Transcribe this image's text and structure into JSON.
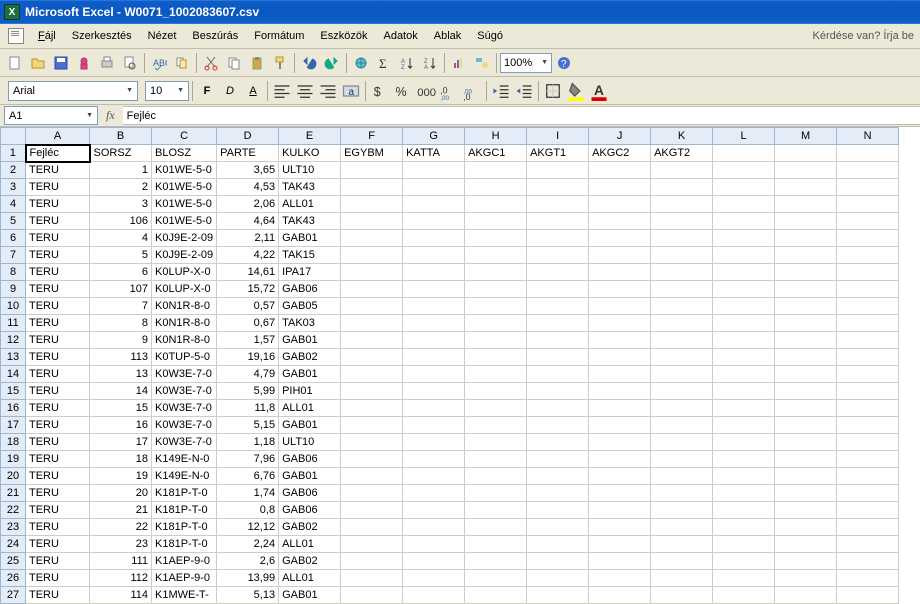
{
  "title": "Microsoft Excel - W0071_1002083607.csv",
  "question_prompt": "Kérdése van? Írja be",
  "menu": {
    "file": "Fájl",
    "edit": "Szerkesztés",
    "view": "Nézet",
    "insert": "Beszúrás",
    "format": "Formátum",
    "tools": "Eszközök",
    "data": "Adatok",
    "window": "Ablak",
    "help": "Súgó"
  },
  "toolbar": {
    "zoom": "100%"
  },
  "format_bar": {
    "font_name": "Arial",
    "font_size": "10"
  },
  "formula_bar": {
    "name_box": "A1",
    "fx": "fx",
    "content": "Fejléc"
  },
  "columns": [
    "A",
    "B",
    "C",
    "D",
    "E",
    "F",
    "G",
    "H",
    "I",
    "J",
    "K",
    "L",
    "M",
    "N"
  ],
  "headers": {
    "A": "Fejléc",
    "B": "SORSZ",
    "C": "BLOSZ",
    "D": "PARTE",
    "E": "KULKO",
    "F": "EGYBM",
    "G": "KATTA",
    "H": "AKGC1",
    "I": "AKGT1",
    "J": "AKGC2",
    "K": "AKGT2"
  },
  "rows": [
    {
      "A": "TERU",
      "B": 1,
      "C": "K01WE-5-0",
      "D": "3,65",
      "E": "ULT10"
    },
    {
      "A": "TERU",
      "B": 2,
      "C": "K01WE-5-0",
      "D": "4,53",
      "E": "TAK43"
    },
    {
      "A": "TERU",
      "B": 3,
      "C": "K01WE-5-0",
      "D": "2,06",
      "E": "ALL01"
    },
    {
      "A": "TERU",
      "B": 106,
      "C": "K01WE-5-0",
      "D": "4,64",
      "E": "TAK43"
    },
    {
      "A": "TERU",
      "B": 4,
      "C": "K0J9E-2-09",
      "D": "2,11",
      "E": "GAB01"
    },
    {
      "A": "TERU",
      "B": 5,
      "C": "K0J9E-2-09",
      "D": "4,22",
      "E": "TAK15"
    },
    {
      "A": "TERU",
      "B": 6,
      "C": "K0LUP-X-0",
      "D": "14,61",
      "E": "IPA17"
    },
    {
      "A": "TERU",
      "B": 107,
      "C": "K0LUP-X-0",
      "D": "15,72",
      "E": "GAB06"
    },
    {
      "A": "TERU",
      "B": 7,
      "C": "K0N1R-8-0",
      "D": "0,57",
      "E": "GAB05"
    },
    {
      "A": "TERU",
      "B": 8,
      "C": "K0N1R-8-0",
      "D": "0,67",
      "E": "TAK03"
    },
    {
      "A": "TERU",
      "B": 9,
      "C": "K0N1R-8-0",
      "D": "1,57",
      "E": "GAB01"
    },
    {
      "A": "TERU",
      "B": 113,
      "C": "K0TUP-5-0",
      "D": "19,16",
      "E": "GAB02"
    },
    {
      "A": "TERU",
      "B": 13,
      "C": "K0W3E-7-0",
      "D": "4,79",
      "E": "GAB01"
    },
    {
      "A": "TERU",
      "B": 14,
      "C": "K0W3E-7-0",
      "D": "5,99",
      "E": "PIH01"
    },
    {
      "A": "TERU",
      "B": 15,
      "C": "K0W3E-7-0",
      "D": "11,8",
      "E": "ALL01"
    },
    {
      "A": "TERU",
      "B": 16,
      "C": "K0W3E-7-0",
      "D": "5,15",
      "E": "GAB01"
    },
    {
      "A": "TERU",
      "B": 17,
      "C": "K0W3E-7-0",
      "D": "1,18",
      "E": "ULT10"
    },
    {
      "A": "TERU",
      "B": 18,
      "C": "K149E-N-0",
      "D": "7,96",
      "E": "GAB06"
    },
    {
      "A": "TERU",
      "B": 19,
      "C": "K149E-N-0",
      "D": "6,76",
      "E": "GAB01"
    },
    {
      "A": "TERU",
      "B": 20,
      "C": "K181P-T-0",
      "D": "1,74",
      "E": "GAB06"
    },
    {
      "A": "TERU",
      "B": 21,
      "C": "K181P-T-0",
      "D": "0,8",
      "E": "GAB06"
    },
    {
      "A": "TERU",
      "B": 22,
      "C": "K181P-T-0",
      "D": "12,12",
      "E": "GAB02"
    },
    {
      "A": "TERU",
      "B": 23,
      "C": "K181P-T-0",
      "D": "2,24",
      "E": "ALL01"
    },
    {
      "A": "TERU",
      "B": 111,
      "C": "K1AEP-9-0",
      "D": "2,6",
      "E": "GAB02"
    },
    {
      "A": "TERU",
      "B": 112,
      "C": "K1AEP-9-0",
      "D": "13,99",
      "E": "ALL01"
    },
    {
      "A": "TERU",
      "B": 114,
      "C": "K1MWE-T-",
      "D": "5,13",
      "E": "GAB01"
    }
  ]
}
